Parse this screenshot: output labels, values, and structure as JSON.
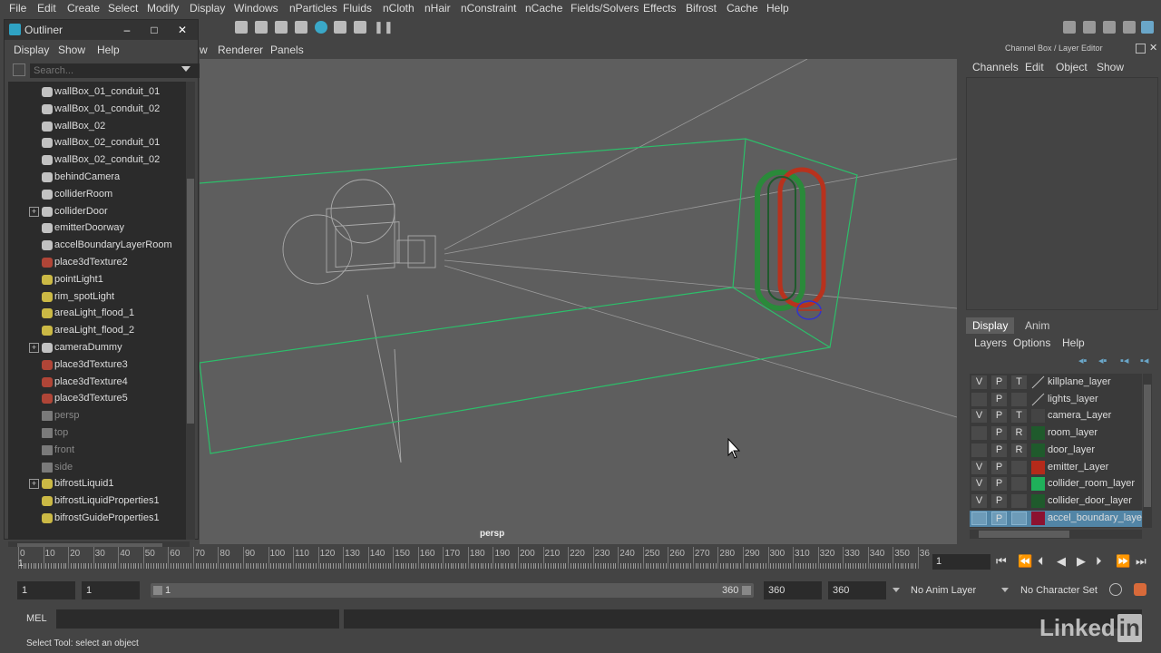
{
  "menubar": [
    "File",
    "Edit",
    "Create",
    "Select",
    "Modify",
    "Display",
    "Windows",
    "nParticles",
    "Fluids",
    "nCloth",
    "nHair",
    "nConstraint",
    "nCache",
    "Fields/Solvers",
    "Effects",
    "Bifrost",
    "Cache",
    "Help"
  ],
  "outliner": {
    "title": "Outliner",
    "minimize": "–",
    "maximize": "□",
    "close": "✕",
    "menu": [
      "Display",
      "Show",
      "Help"
    ],
    "search_placeholder": "Search...",
    "items": [
      {
        "label": "wallBox_01_conduit_01",
        "icon": "transform-icon",
        "expand": false,
        "dim": false
      },
      {
        "label": "wallBox_01_conduit_02",
        "icon": "transform-icon",
        "expand": false,
        "dim": false
      },
      {
        "label": "wallBox_02",
        "icon": "transform-icon",
        "expand": false,
        "dim": false
      },
      {
        "label": "wallBox_02_conduit_01",
        "icon": "transform-icon",
        "expand": false,
        "dim": false
      },
      {
        "label": "wallBox_02_conduit_02",
        "icon": "transform-icon",
        "expand": false,
        "dim": false
      },
      {
        "label": "behindCamera",
        "icon": "transform-icon",
        "expand": false,
        "dim": false
      },
      {
        "label": "colliderRoom",
        "icon": "transform-icon",
        "expand": false,
        "dim": false
      },
      {
        "label": "colliderDoor",
        "icon": "transform-icon",
        "expand": true,
        "dim": false
      },
      {
        "label": "emitterDoorway",
        "icon": "transform-icon",
        "expand": false,
        "dim": false
      },
      {
        "label": "accelBoundaryLayerRoom",
        "icon": "transform-icon",
        "expand": false,
        "dim": false
      },
      {
        "label": "place3dTexture2",
        "icon": "texture-icon",
        "expand": false,
        "dim": false
      },
      {
        "label": "pointLight1",
        "icon": "light-icon",
        "expand": false,
        "dim": false
      },
      {
        "label": "rim_spotLight",
        "icon": "spotlight-icon",
        "expand": false,
        "dim": false
      },
      {
        "label": "areaLight_flood_1",
        "icon": "area-light-icon",
        "expand": false,
        "dim": false
      },
      {
        "label": "areaLight_flood_2",
        "icon": "area-light-icon",
        "expand": false,
        "dim": false
      },
      {
        "label": "cameraDummy",
        "icon": "transform-icon",
        "expand": true,
        "dim": false
      },
      {
        "label": "place3dTexture3",
        "icon": "texture-icon",
        "expand": false,
        "dim": false
      },
      {
        "label": "place3dTexture4",
        "icon": "texture-icon",
        "expand": false,
        "dim": false
      },
      {
        "label": "place3dTexture5",
        "icon": "texture-icon",
        "expand": false,
        "dim": false
      },
      {
        "label": "persp",
        "icon": "camera-icon",
        "expand": false,
        "dim": true
      },
      {
        "label": "top",
        "icon": "camera-icon",
        "expand": false,
        "dim": true
      },
      {
        "label": "front",
        "icon": "camera-icon",
        "expand": false,
        "dim": true
      },
      {
        "label": "side",
        "icon": "camera-icon",
        "expand": false,
        "dim": true
      },
      {
        "label": "bifrostLiquid1",
        "icon": "bifrost-icon",
        "expand": true,
        "dim": false
      },
      {
        "label": "bifrostLiquidProperties1",
        "icon": "bifrost-icon",
        "expand": false,
        "dim": false
      },
      {
        "label": "bifrostGuideProperties1",
        "icon": "bifrost-icon",
        "expand": false,
        "dim": false
      }
    ]
  },
  "viewport": {
    "menu": [
      "w",
      "Renderer",
      "Panels"
    ],
    "camera_label": "persp"
  },
  "channelbox": {
    "title": "Channel Box / Layer Editor",
    "menu": [
      "Channels",
      "Edit",
      "Object",
      "Show"
    ]
  },
  "layereditor": {
    "tabs": [
      "Display",
      "Anim"
    ],
    "menu": [
      "Layers",
      "Options",
      "Help"
    ],
    "layers": [
      {
        "v": "V",
        "p": "P",
        "t": "T",
        "name": "killplane_layer",
        "color": "none",
        "sel": false
      },
      {
        "v": "",
        "p": "P",
        "t": "",
        "name": "lights_layer",
        "color": "none",
        "sel": false
      },
      {
        "v": "V",
        "p": "P",
        "t": "T",
        "name": "camera_Layer",
        "color": "#444444",
        "sel": false
      },
      {
        "v": "",
        "p": "P",
        "t": "R",
        "name": "room_layer",
        "color": "#1f5a2c",
        "sel": false
      },
      {
        "v": "",
        "p": "P",
        "t": "R",
        "name": "door_layer",
        "color": "#1f5a2c",
        "sel": false
      },
      {
        "v": "V",
        "p": "P",
        "t": "",
        "name": "emitter_Layer",
        "color": "#b52a1a",
        "sel": false
      },
      {
        "v": "V",
        "p": "P",
        "t": "",
        "name": "collider_room_layer",
        "color": "#1fb05a",
        "sel": false
      },
      {
        "v": "V",
        "p": "P",
        "t": "",
        "name": "collider_door_layer",
        "color": "#1f5a2c",
        "sel": false
      },
      {
        "v": "",
        "p": "P",
        "t": "",
        "name": "accel_boundary_layer",
        "color": "#8c1230",
        "sel": true
      }
    ]
  },
  "timeline": {
    "ticks": [
      "0",
      "10",
      "20",
      "30",
      "40",
      "50",
      "60",
      "70",
      "80",
      "90",
      "100",
      "110",
      "120",
      "130",
      "140",
      "150",
      "160",
      "170",
      "180",
      "190",
      "200",
      "210",
      "220",
      "230",
      "240",
      "250",
      "260",
      "270",
      "280",
      "290",
      "300",
      "310",
      "320",
      "330",
      "340",
      "350",
      "36"
    ],
    "current_marker": "1",
    "current_frame": "1"
  },
  "range": {
    "start": "1",
    "playback_start": "1",
    "bar_start": "1",
    "bar_end": "360",
    "playback_end": "360",
    "end": "360",
    "anim_layer": "No Anim Layer",
    "character_set": "No Character Set"
  },
  "mel": {
    "label": "MEL"
  },
  "status": "Select Tool: select an object",
  "watermark": "Linked"
}
